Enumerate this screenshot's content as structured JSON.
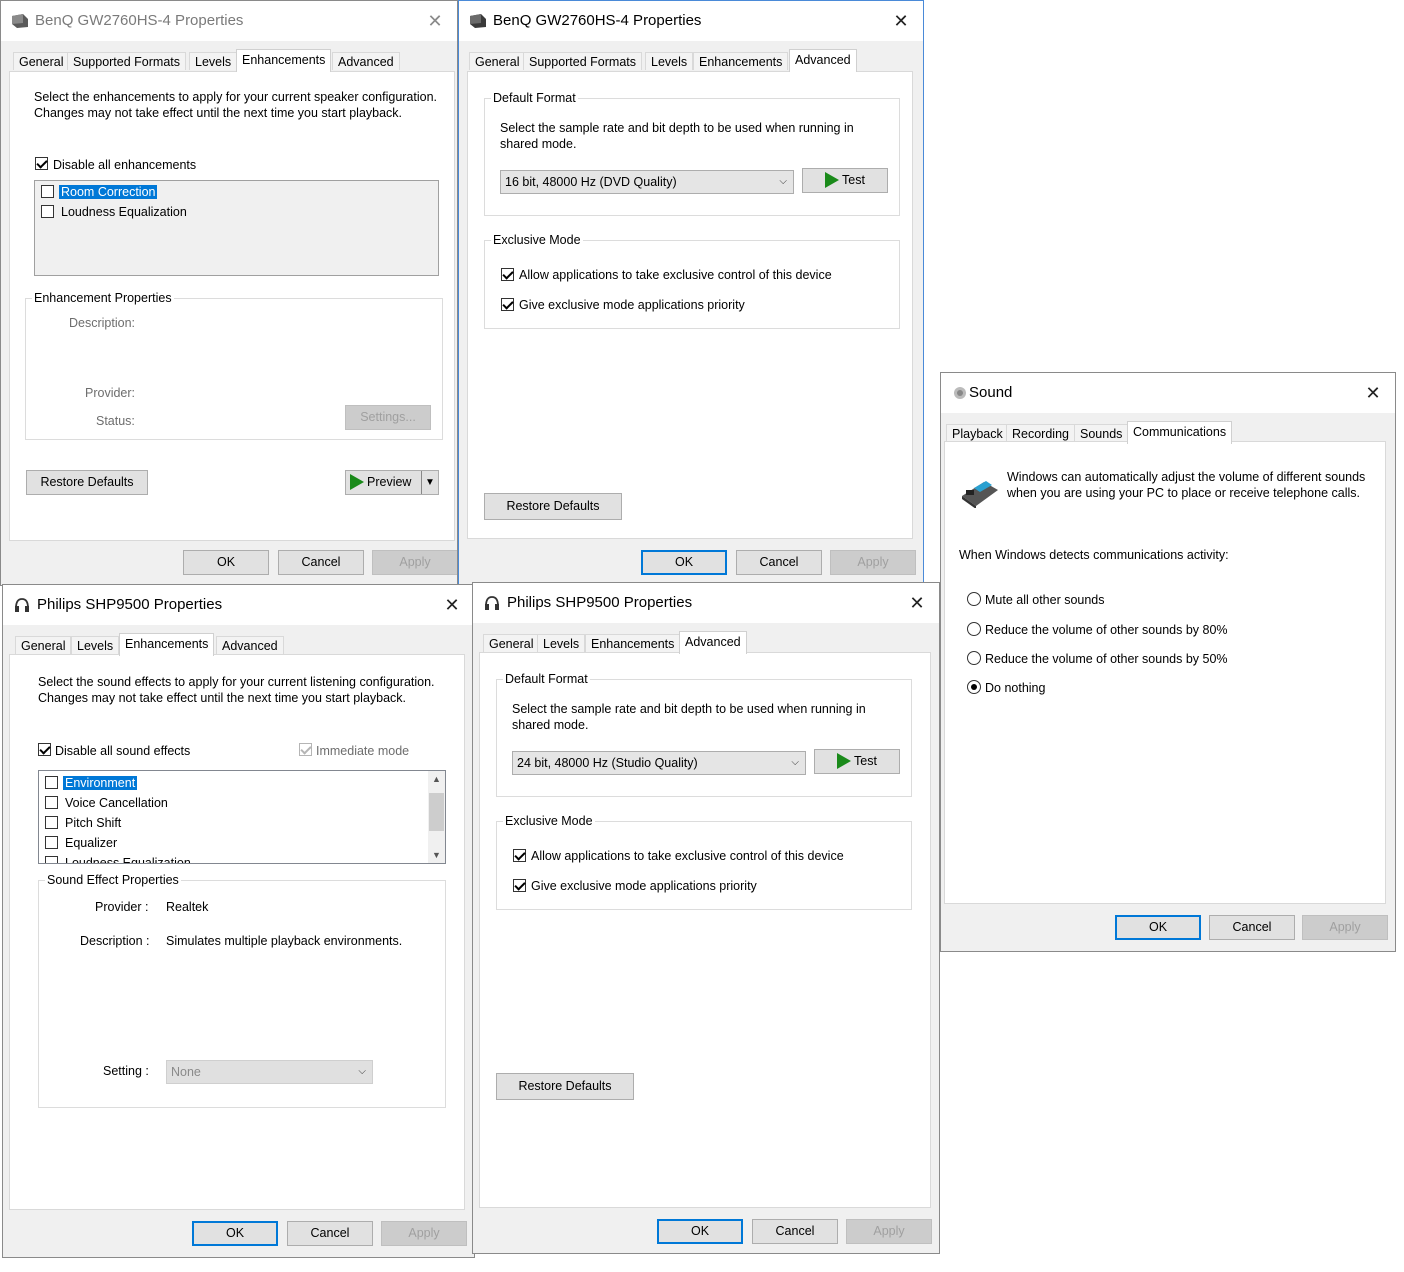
{
  "benq_enh": {
    "title": "BenQ GW2760HS-4 Properties",
    "tabs": [
      "General",
      "Supported Formats",
      "Levels",
      "Enhancements",
      "Advanced"
    ],
    "intro": "Select the enhancements to apply for your current speaker configuration. Changes may not take effect until the next time you start playback.",
    "disable_all": "Disable all enhancements",
    "list": [
      "Room Correction",
      "Loudness Equalization"
    ],
    "props_group": "Enhancement Properties",
    "description_label": "Description:",
    "provider_label": "Provider:",
    "status_label": "Status:",
    "settings_btn": "Settings...",
    "restore_btn": "Restore Defaults",
    "preview_btn": "Preview",
    "ok": "OK",
    "cancel": "Cancel",
    "apply": "Apply"
  },
  "benq_adv": {
    "title": "BenQ GW2760HS-4 Properties",
    "tabs": [
      "General",
      "Supported Formats",
      "Levels",
      "Enhancements",
      "Advanced"
    ],
    "default_format_group": "Default Format",
    "format_desc": "Select the sample rate and bit depth to be used when running in shared mode.",
    "format_value": "16 bit, 48000 Hz (DVD Quality)",
    "test_btn": "Test",
    "exclusive_group": "Exclusive Mode",
    "allow_exclusive": "Allow applications to take exclusive control of this device",
    "give_priority": "Give exclusive mode applications priority",
    "restore_btn": "Restore Defaults",
    "ok": "OK",
    "cancel": "Cancel",
    "apply": "Apply"
  },
  "sound": {
    "title": "Sound",
    "tabs": [
      "Playback",
      "Recording",
      "Sounds",
      "Communications"
    ],
    "intro": "Windows can automatically adjust the volume of different sounds when you are using your PC to place or receive telephone calls.",
    "detect_label": "When Windows detects communications activity:",
    "options": [
      "Mute all other sounds",
      "Reduce the volume of other sounds by 80%",
      "Reduce the volume of other sounds by 50%",
      "Do nothing"
    ],
    "ok": "OK",
    "cancel": "Cancel",
    "apply": "Apply"
  },
  "philips_enh": {
    "title": "Philips SHP9500 Properties",
    "tabs": [
      "General",
      "Levels",
      "Enhancements",
      "Advanced"
    ],
    "intro": "Select the sound effects to apply for your current listening configuration. Changes may not take effect until the next time you start playback.",
    "disable_all": "Disable all sound effects",
    "immediate_mode": "Immediate mode",
    "list": [
      "Environment",
      "Voice Cancellation",
      "Pitch Shift",
      "Equalizer",
      "Loudness Equalization"
    ],
    "props_group": "Sound Effect Properties",
    "provider_label": "Provider :",
    "provider_value": "Realtek",
    "description_label": "Description :",
    "description_value": "Simulates multiple playback environments.",
    "setting_label": "Setting :",
    "setting_value": "None",
    "ok": "OK",
    "cancel": "Cancel",
    "apply": "Apply"
  },
  "philips_adv": {
    "title": "Philips SHP9500 Properties",
    "tabs": [
      "General",
      "Levels",
      "Enhancements",
      "Advanced"
    ],
    "default_format_group": "Default Format",
    "format_desc": "Select the sample rate and bit depth to be used when running in shared mode.",
    "format_value": "24 bit, 48000 Hz (Studio Quality)",
    "test_btn": "Test",
    "exclusive_group": "Exclusive Mode",
    "allow_exclusive": "Allow applications to take exclusive control of this device",
    "give_priority": "Give exclusive mode applications priority",
    "restore_btn": "Restore Defaults",
    "ok": "OK",
    "cancel": "Cancel",
    "apply": "Apply"
  }
}
